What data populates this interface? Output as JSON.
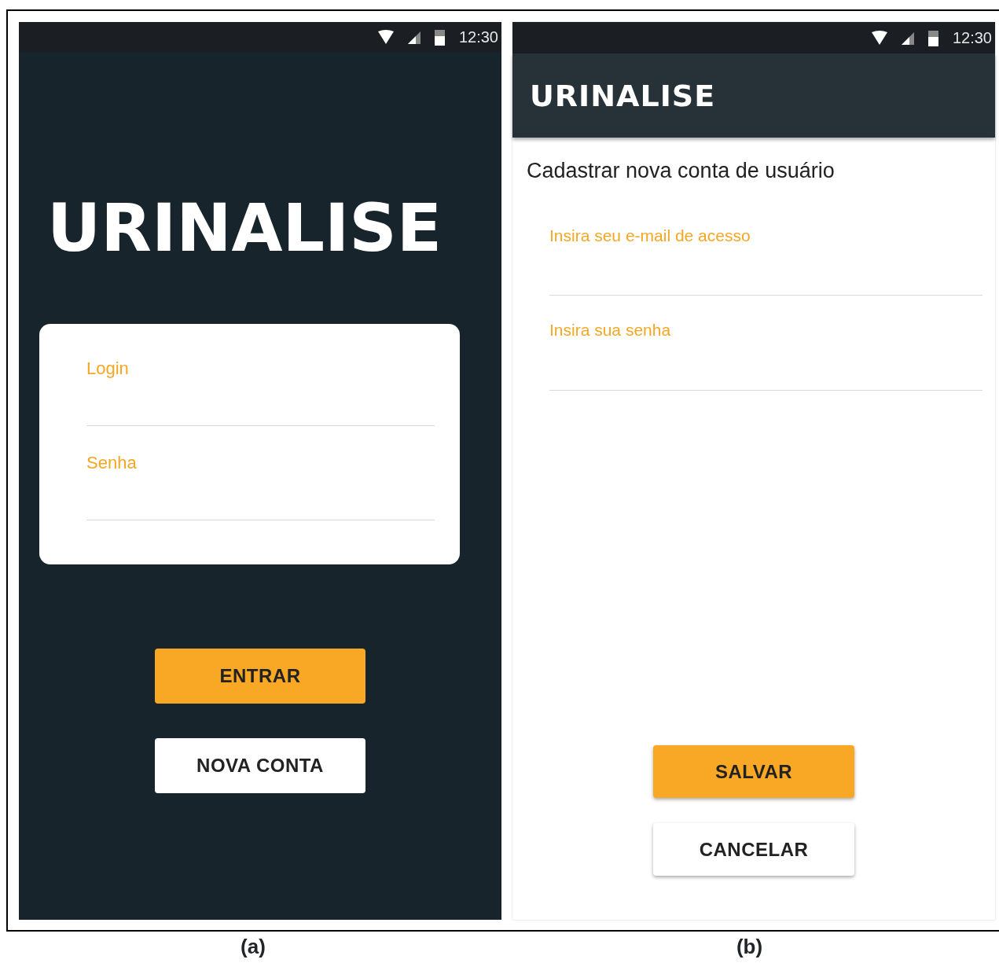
{
  "panels": [
    {
      "kind": "login",
      "caption": "(a)",
      "status_bar": {
        "time": "12:30"
      },
      "logo": "URINALISE",
      "fields": [
        {
          "placeholder": "Login"
        },
        {
          "placeholder": "Senha"
        }
      ],
      "buttons": [
        {
          "label": "ENTRAR",
          "kind": "primary"
        },
        {
          "label": "NOVA CONTA",
          "kind": "secondary"
        }
      ]
    },
    {
      "kind": "register",
      "caption": "(b)",
      "status_bar": {
        "time": "12:30"
      },
      "logo": "URINALISE",
      "heading": "Cadastrar nova conta de usuário",
      "fields": [
        {
          "placeholder": "Insira seu e-mail de acesso"
        },
        {
          "placeholder": "Insira sua senha"
        }
      ],
      "buttons": [
        {
          "label": "SALVAR",
          "kind": "primary"
        },
        {
          "label": "CANCELAR",
          "kind": "secondary"
        }
      ]
    }
  ]
}
